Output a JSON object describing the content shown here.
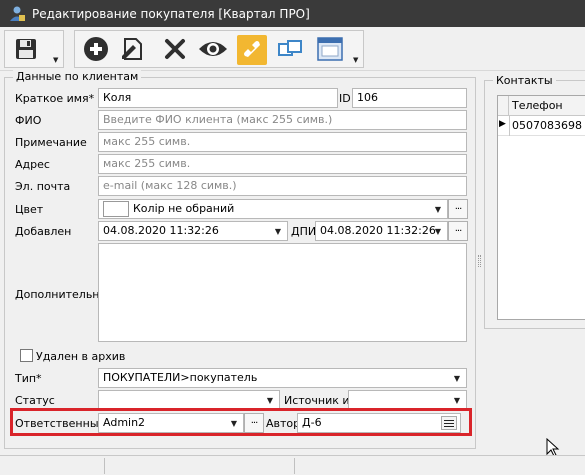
{
  "window": {
    "title": "Редактирование покупателя [Квартал ПРО]"
  },
  "toolbar": {
    "buttons": [
      {
        "name": "save",
        "icon": "floppy-disk-icon"
      },
      {
        "name": "add",
        "icon": "plus-circle-icon"
      },
      {
        "name": "edit",
        "icon": "edit-document-icon"
      },
      {
        "name": "delete",
        "icon": "x-icon"
      },
      {
        "name": "view",
        "icon": "eye-icon"
      },
      {
        "name": "call",
        "icon": "phone-icon"
      },
      {
        "name": "copy",
        "icon": "copy-windows-icon"
      },
      {
        "name": "window",
        "icon": "window-icon"
      }
    ]
  },
  "client_group": {
    "title": "Данные по клиентам",
    "short_name": {
      "label": "Краткое имя*",
      "value": "Коля"
    },
    "id": {
      "label": "ID",
      "value": "106"
    },
    "fio": {
      "label": "ФИО",
      "placeholder": "Введите ФИО клиента (макс 255 симв.)"
    },
    "note": {
      "label": "Примечание",
      "placeholder": "макс 255 симв."
    },
    "address": {
      "label": "Адрес",
      "placeholder": "макс 255 симв."
    },
    "email": {
      "label": "Эл. почта",
      "placeholder": "e-mail (макс 128 симв.)"
    },
    "color": {
      "label": "Цвет",
      "value": "Колір не обраний",
      "more": "···"
    },
    "added": {
      "label": "Добавлен",
      "value": "04.08.2020 11:32:26"
    },
    "dpi": {
      "label": "ДПИ",
      "value": "04.08.2020 11:32:26"
    },
    "additional": {
      "label": "Дополнительно",
      "value": ""
    },
    "archived": {
      "label": "Удален в архив",
      "checked": false
    },
    "type": {
      "label": "Тип*",
      "value": "ПОКУПАТЕЛИ>покупатель"
    },
    "status": {
      "label": "Статус",
      "value": ""
    },
    "source": {
      "label": "Источник инф.",
      "value": ""
    },
    "responsible": {
      "label": "Ответственный",
      "value": "Admin2",
      "more": "···"
    },
    "author": {
      "label": "Автор",
      "value": "Д-6"
    }
  },
  "contacts_group": {
    "title": "Контакты",
    "columns": [
      "Телефон"
    ],
    "rows": [
      {
        "phone": "0507083698"
      }
    ]
  },
  "colors": {
    "highlight": "#d9242a",
    "titlebar": "#3a3a3a"
  }
}
